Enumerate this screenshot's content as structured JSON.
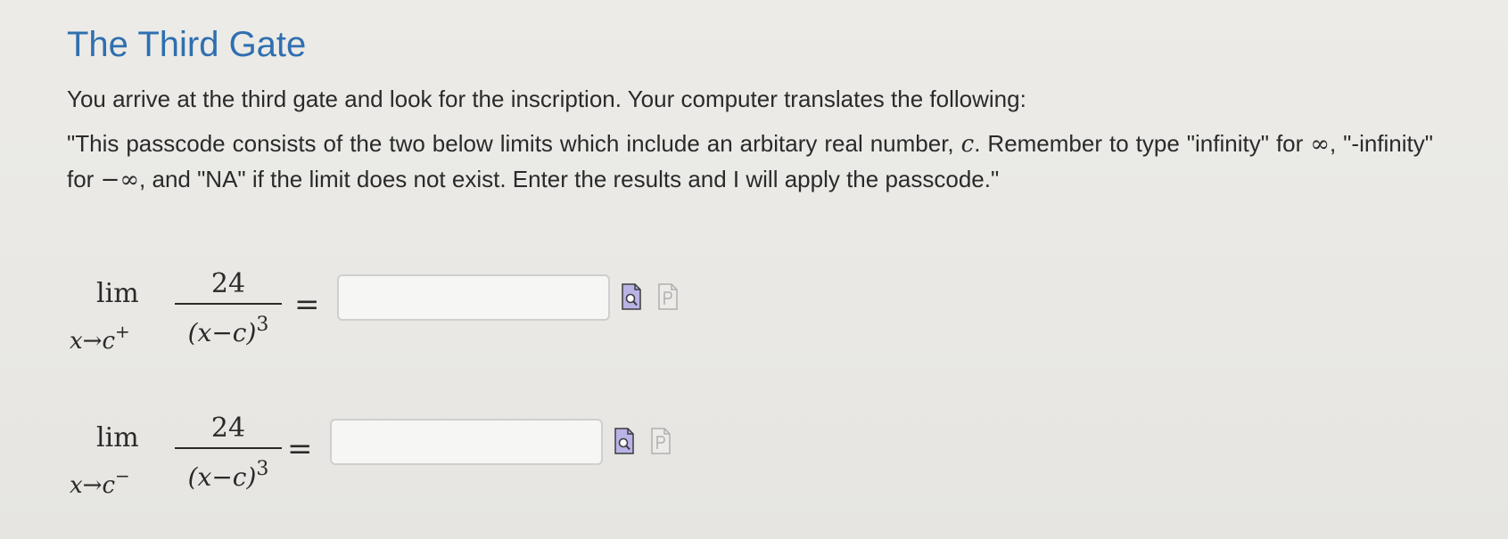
{
  "title": "The Third Gate",
  "intro": "You arrive at the third gate and look for the inscription. Your computer translates the following:",
  "quote": {
    "part1": "\"This passcode consists of the two below limits which include an arbitary real number, ",
    "var_c": "c",
    "part2": ". Remember to type \"infinity\" for ",
    "infinity_symbol": "∞",
    "part3": ", \"-infinity\" for ",
    "neg_infinity_symbol": "−∞",
    "part4": ", and \"NA\" if the limit does not exist. Enter the results and I will apply the passcode.\""
  },
  "limits": [
    {
      "lim": "lim",
      "subscript": "x→c",
      "direction": "+",
      "numerator": "24",
      "denominator": "(x−c)",
      "exponent": "3",
      "equals": "=",
      "answer_value": "",
      "answer_placeholder": ""
    },
    {
      "lim": "lim",
      "subscript": "x→c",
      "direction": "−",
      "numerator": "24",
      "denominator": "(x−c)",
      "exponent": "3",
      "equals": "=",
      "answer_value": "",
      "answer_placeholder": ""
    }
  ],
  "icons": {
    "preview": "preview-answer-icon",
    "help": "formula-help-icon"
  },
  "colors": {
    "title": "#2f6fb0",
    "preview_icon_fill": "#b9b3e6",
    "help_icon_fill": "#ecebe7",
    "input_border": "#cfcfcf"
  }
}
